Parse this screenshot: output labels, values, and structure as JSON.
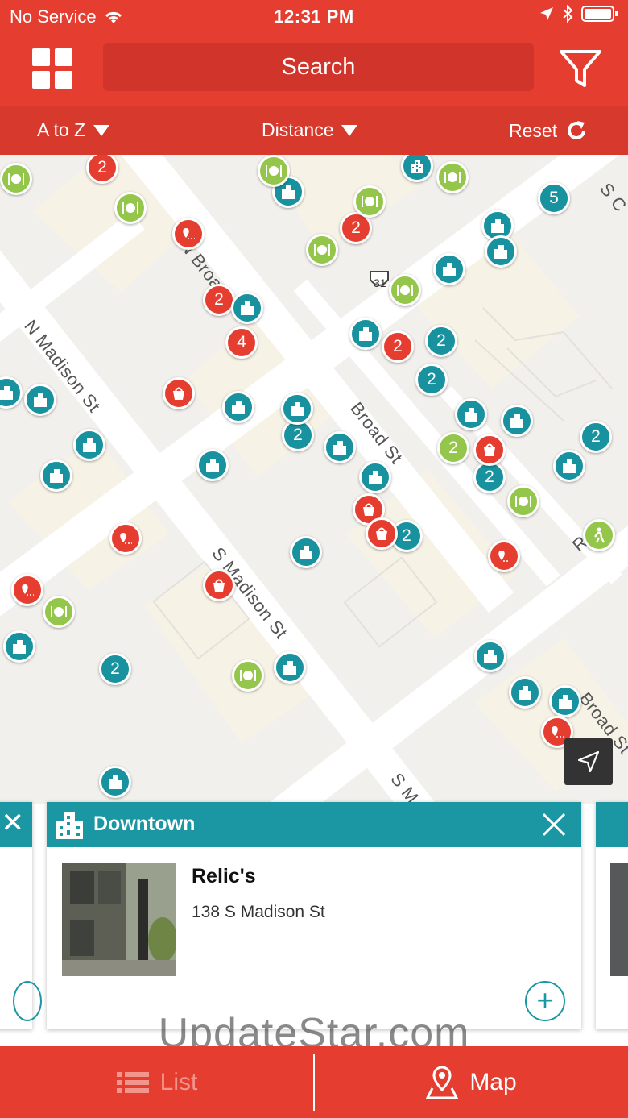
{
  "status_bar": {
    "carrier": "No Service",
    "time": "12:31 PM"
  },
  "header": {
    "search_placeholder": "Search"
  },
  "sort_bar": {
    "az_label": "A to Z",
    "distance_label": "Distance",
    "reset_label": "Reset"
  },
  "map": {
    "streets": [
      "N Broad St",
      "N Madison St",
      "Broad St",
      "S Madison St",
      "Broad St",
      "S M",
      "Ro",
      "S C"
    ],
    "route_shield": "31",
    "cluster_counts": [
      "2",
      "2",
      "2",
      "4",
      "2",
      "2",
      "2",
      "2",
      "2",
      "5",
      "2",
      "2",
      "2",
      "2"
    ]
  },
  "card": {
    "category": "Downtown",
    "title": "Relic's",
    "address": "138 S Madison St"
  },
  "watermark": "UpdateStar.com",
  "tabs": {
    "list_label": "List",
    "map_label": "Map"
  },
  "colors": {
    "brand_red": "#e53e30",
    "teal": "#1a97a3",
    "green": "#93c64a"
  }
}
